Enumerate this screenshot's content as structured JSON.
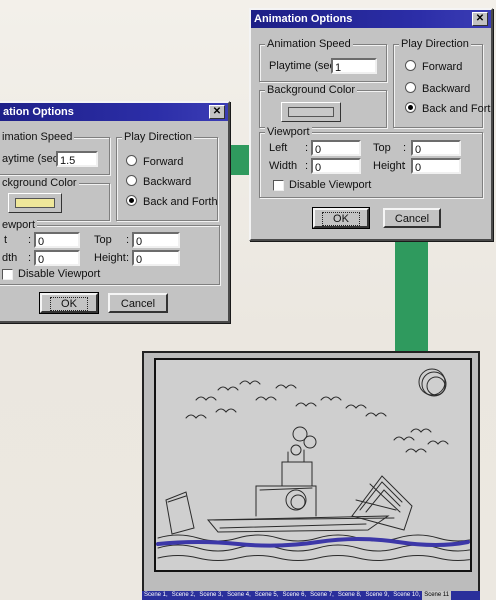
{
  "dialog_left": {
    "title": "ation Options",
    "close_glyph": "✕",
    "speed_group_label": "imation Speed",
    "playtime_label": "aytime (sec):",
    "playtime_value": "1.5",
    "bg_group_label": "ckground Color",
    "bg_color": "#efe79a",
    "direction_label": "Play Direction",
    "radio_forward": "Forward",
    "radio_backward": "Backward",
    "radio_backforth": "Back and Forth",
    "viewport_label": "ewport",
    "left_label": "t",
    "left_value": "0",
    "top_label": "Top",
    "top_value": "0",
    "width_label": "dth",
    "width_value": "0",
    "height_label": "Height",
    "height_value": "0",
    "disable_label": "Disable Viewport",
    "ok_label": "OK",
    "cancel_label": "Cancel"
  },
  "dialog_right": {
    "title": "Animation Options",
    "close_glyph": "✕",
    "speed_group_label": "Animation Speed",
    "playtime_label": "Playtime (sec):",
    "playtime_value": "1",
    "bg_group_label": "Background Color",
    "bg_color": "#c8c8c8",
    "direction_label": "Play Direction",
    "radio_forward": "Forward",
    "radio_backward": "Backward",
    "radio_backforth": "Back and Forth",
    "viewport_label": "Viewport",
    "left_label": "Left",
    "left_value": "0",
    "top_label": "Top",
    "top_value": "0",
    "width_label": "Width",
    "width_value": "0",
    "height_label": "Height",
    "height_value": "0",
    "disable_label": "Disable Viewport",
    "ok_label": "OK",
    "cancel_label": "Cancel"
  },
  "scene_bar": {
    "tabs": [
      "Scene 1",
      "Scene 2",
      "Scene 3",
      "Scene 4",
      "Scene 5",
      "Scene 6",
      "Scene 7",
      "Scene 8",
      "Scene 9",
      "Scene 10"
    ],
    "current": "Scene 11"
  },
  "colors": {
    "titlebar": "#1d1f86",
    "connector": "#2f9a5e",
    "water": "#3c37a8"
  }
}
